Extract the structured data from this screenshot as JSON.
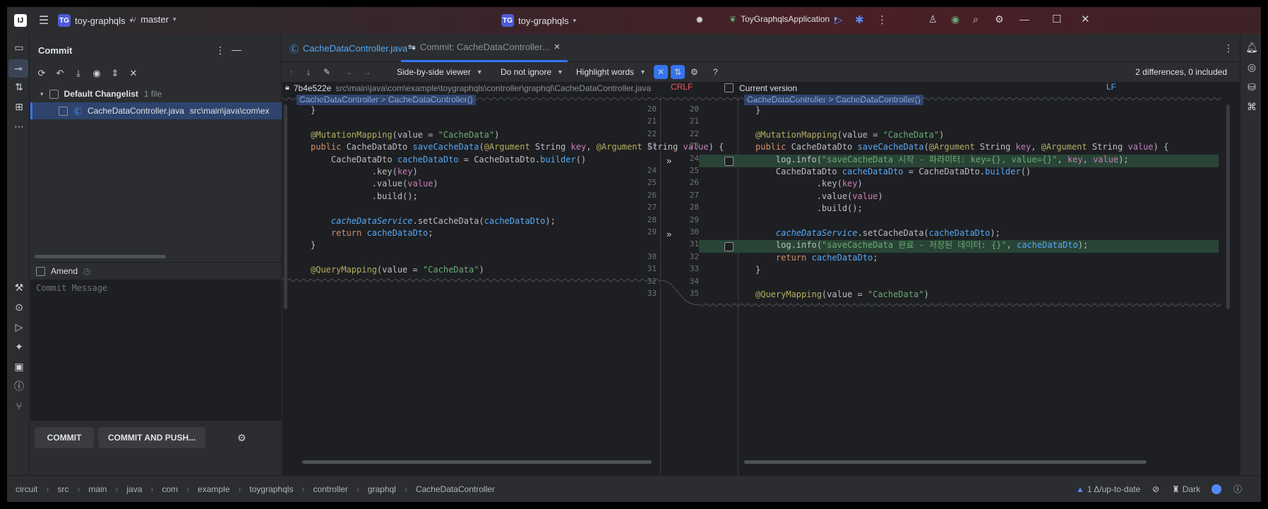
{
  "titlebar": {
    "project_badge": "TG",
    "project_name": "toy-graphqls",
    "branch": "master",
    "center_badge": "TG",
    "center_project": "toy-graphqls",
    "run_config": "ToyGraphqlsApplication"
  },
  "commit_panel": {
    "title": "Commit",
    "changelist_name": "Default Changelist",
    "changelist_count": "1 file",
    "file_name": "CacheDataController.java",
    "file_path": "src\\main\\java\\com\\ex",
    "amend_label": "Amend",
    "message_placeholder": "Commit Message",
    "commit_button": "COMMIT",
    "commit_push_button": "COMMIT AND PUSH..."
  },
  "tabs": {
    "file_tab": "CacheDataController.java",
    "commit_tab": "Commit: CacheDataController..."
  },
  "diff_toolbar": {
    "viewer": "Side-by-side viewer",
    "ignore": "Do not ignore",
    "highlight": "Highlight words",
    "help": "?",
    "summary": "2 differences, 0 included"
  },
  "diff": {
    "left_revision": "7b4e522e",
    "left_path": "src\\main\\java\\com\\example\\toygraphqls\\controller\\graphql\\CacheDataController.java",
    "left_line_sep": "CRLF",
    "right_label": "Current version",
    "right_line_sep": "LF",
    "breadcrumb_left": "CacheDataController > CacheDataController()",
    "breadcrumb_right": "CacheDataController > CacheDataController()",
    "left_numbers": [
      "20",
      "21",
      "22",
      "23",
      "24",
      "25",
      "26",
      "27",
      "28",
      "29",
      "30",
      "31",
      "32",
      "33"
    ],
    "right_numbers": [
      "20",
      "21",
      "22",
      "23",
      "24",
      "25",
      "26",
      "27",
      "28",
      "29",
      "30",
      "31",
      "32",
      "33",
      "34",
      "35"
    ],
    "right_log1_text": "\"saveCacheData 시작 - 파라미터: key={}, value={}\"",
    "right_log2_text": "\"saveCacheData 완료 - 저장된 데이터: {}\""
  },
  "statusbar": {
    "crumbs": [
      "circuit",
      "src",
      "main",
      "java",
      "com",
      "example",
      "toygraphqls",
      "controller",
      "graphql",
      "CacheDataController"
    ],
    "vcs_status": "1 Δ/up-to-date",
    "theme": "Dark"
  }
}
